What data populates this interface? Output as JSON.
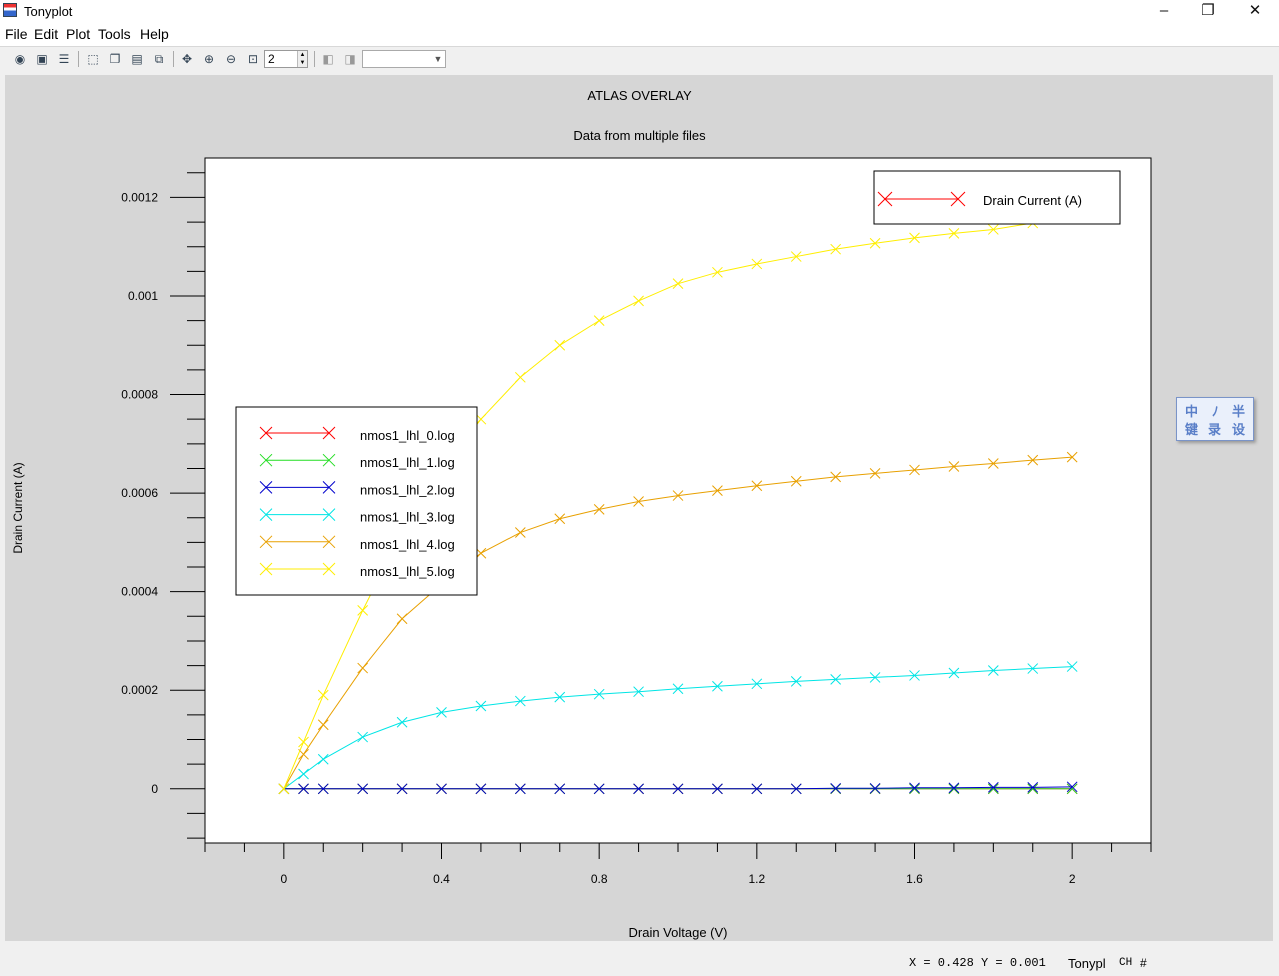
{
  "window": {
    "title": "Tonyplot",
    "minimize": "–",
    "maximize": "❐",
    "close": "✕"
  },
  "menu": [
    "File",
    "Edit",
    "Plot",
    "Tools",
    "Help"
  ],
  "toolbar": {
    "zoom_value": "2",
    "combo_value": ""
  },
  "plot": {
    "title": "ATLAS OVERLAY",
    "subtitle": "Data from multiple files"
  },
  "status": {
    "readout": "X = 0.428 Y = 0.001",
    "app_label": "Tonypl",
    "ime": "CH",
    "grid_icon": "#"
  },
  "widget": {
    "c1": "中",
    "c2": "ﾉ",
    "c3": "半",
    "c4": "键",
    "c5": "录",
    "c6": "设"
  },
  "chart_data": {
    "type": "line",
    "xlabel": "Drain Voltage (V)",
    "ylabel": "Drain Current (A)",
    "xlim": [
      -0.2,
      2.2
    ],
    "ylim": [
      -0.00011,
      0.00128
    ],
    "xticks": [
      0,
      0.4,
      0.8,
      1.2,
      1.6,
      2
    ],
    "xtick_labels": [
      "0",
      "0.4",
      "0.8",
      "1.2",
      "1.6",
      "2"
    ],
    "yticks": [
      0,
      0.0002,
      0.0004,
      0.0006,
      0.0008,
      0.001,
      0.0012
    ],
    "ytick_labels": [
      "0",
      "0.0002",
      "0.0004",
      "0.0006",
      "0.0008",
      "0.001",
      "0.0012"
    ],
    "legend_title": "Drain Current (A)",
    "legend_title_color": "#ff0000",
    "x": [
      0,
      0.05,
      0.1,
      0.2,
      0.3,
      0.4,
      0.5,
      0.6,
      0.7,
      0.8,
      0.9,
      1.0,
      1.1,
      1.2,
      1.3,
      1.4,
      1.5,
      1.6,
      1.7,
      1.8,
      1.9,
      2.0
    ],
    "series": [
      {
        "name": "nmos1_lhl_0.log",
        "color": "#ff0000",
        "values": [
          0,
          0,
          0,
          0,
          0,
          0,
          0,
          0,
          0,
          0,
          0,
          0,
          0,
          0,
          0,
          0,
          0,
          0,
          0,
          0,
          0,
          0
        ]
      },
      {
        "name": "nmos1_lhl_1.log",
        "color": "#22dd22",
        "values": [
          0,
          0,
          0,
          0,
          0,
          0,
          0,
          0,
          0,
          0,
          0,
          0,
          0,
          0,
          0,
          0,
          0,
          0,
          0,
          0,
          0,
          0
        ]
      },
      {
        "name": "nmos1_lhl_2.log",
        "color": "#0000cc",
        "values": [
          0,
          0,
          0,
          0,
          0,
          0,
          0,
          0,
          0,
          0,
          0,
          0,
          0,
          0,
          0,
          1e-06,
          1e-06,
          2e-06,
          2e-06,
          3e-06,
          3e-06,
          4e-06
        ]
      },
      {
        "name": "nmos1_lhl_3.log",
        "color": "#00e5e5",
        "values": [
          0,
          3e-05,
          6e-05,
          0.000105,
          0.000135,
          0.000155,
          0.000168,
          0.000178,
          0.000186,
          0.000192,
          0.000197,
          0.000203,
          0.000208,
          0.000213,
          0.000218,
          0.000222,
          0.000226,
          0.00023,
          0.000235,
          0.00024,
          0.000244,
          0.000248
        ]
      },
      {
        "name": "nmos1_lhl_4.log",
        "color": "#e8a000",
        "values": [
          0,
          7e-05,
          0.00013,
          0.000245,
          0.000345,
          0.000415,
          0.000478,
          0.00052,
          0.000548,
          0.000567,
          0.000583,
          0.000595,
          0.000605,
          0.000615,
          0.000624,
          0.000633,
          0.00064,
          0.000647,
          0.000654,
          0.00066,
          0.000667,
          0.000673
        ]
      },
      {
        "name": "nmos1_lhl_5.log",
        "color": "#ffee00",
        "values": [
          0,
          9.5e-05,
          0.00019,
          0.000362,
          0.00052,
          0.000645,
          0.00075,
          0.000835,
          0.0009,
          0.00095,
          0.00099,
          0.001025,
          0.001048,
          0.001065,
          0.00108,
          0.001095,
          0.001107,
          0.001118,
          0.001127,
          0.001135,
          0.001148,
          0.001158
        ]
      }
    ]
  }
}
